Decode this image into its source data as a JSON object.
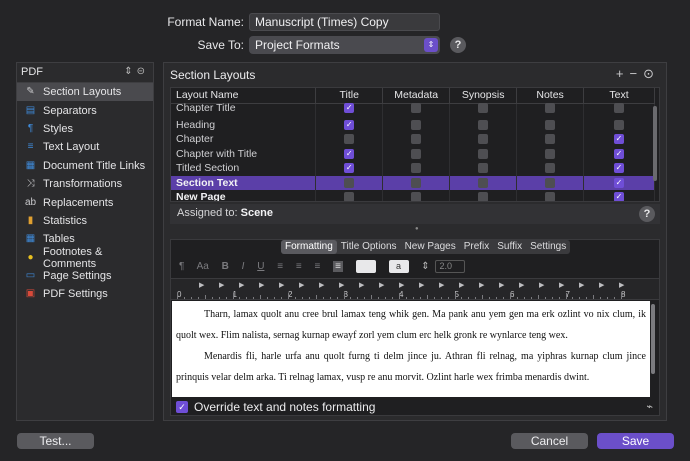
{
  "header": {
    "format_name_label": "Format Name:",
    "format_name_value": "Manuscript (Times) Copy",
    "save_to_label": "Save To:",
    "save_to_value": "Project Formats",
    "help": "?"
  },
  "sidebar": {
    "top_label": "PDF",
    "items": [
      {
        "label": "Section Layouts",
        "icon": "brush-icon",
        "glyph": "✎",
        "color": "#c9c9cc"
      },
      {
        "label": "Separators",
        "icon": "separators-icon",
        "glyph": "▤",
        "color": "#3f8ad8"
      },
      {
        "label": "Styles",
        "icon": "styles-icon",
        "glyph": "¶",
        "color": "#3f8ad8"
      },
      {
        "label": "Text Layout",
        "icon": "text-layout-icon",
        "glyph": "≡",
        "color": "#3f8ad8"
      },
      {
        "label": "Document Title Links",
        "icon": "document-links-icon",
        "glyph": "▦",
        "color": "#3f8ad8"
      },
      {
        "label": "Transformations",
        "icon": "transformations-icon",
        "glyph": "⤨",
        "color": "#c9c9cc"
      },
      {
        "label": "Replacements",
        "icon": "replacements-icon",
        "glyph": "ab",
        "color": "#c9c9cc"
      },
      {
        "label": "Statistics",
        "icon": "statistics-icon",
        "glyph": "▮",
        "color": "#e0a030"
      },
      {
        "label": "Tables",
        "icon": "tables-icon",
        "glyph": "▦",
        "color": "#3f8ad8"
      },
      {
        "label": "Footnotes & Comments",
        "icon": "footnotes-icon",
        "glyph": "●",
        "color": "#e8c020"
      },
      {
        "label": "Page Settings",
        "icon": "page-settings-icon",
        "glyph": "▭",
        "color": "#3f8ad8"
      },
      {
        "label": "PDF Settings",
        "icon": "pdf-settings-icon",
        "glyph": "▣",
        "color": "#d84a3a"
      }
    ]
  },
  "panel": {
    "title": "Section Layouts",
    "columns": [
      "Layout Name",
      "Title",
      "Metadata",
      "Synopsis",
      "Notes",
      "Text"
    ],
    "rows": [
      {
        "name": "Chapter Title",
        "checks": [
          true,
          false,
          false,
          false,
          false
        ]
      },
      {
        "name": "Heading",
        "checks": [
          true,
          false,
          false,
          false,
          false
        ]
      },
      {
        "name": "Chapter",
        "checks": [
          false,
          false,
          false,
          false,
          true
        ]
      },
      {
        "name": "Chapter with Title",
        "checks": [
          true,
          false,
          false,
          false,
          true
        ]
      },
      {
        "name": "Titled Section",
        "checks": [
          true,
          false,
          false,
          false,
          true
        ]
      },
      {
        "name": "Section Text",
        "checks": [
          false,
          false,
          false,
          false,
          true
        ]
      },
      {
        "name": "New Page",
        "checks": [
          false,
          false,
          false,
          false,
          true
        ]
      }
    ],
    "assigned_label": "Assigned to:",
    "assigned_value": "Scene"
  },
  "tabs": [
    "Formatting",
    "Title Options",
    "New Pages",
    "Prefix",
    "Suffix",
    "Settings"
  ],
  "format_bar": {
    "paragraph_glyph": "¶",
    "font_glyph": "Aa",
    "bold": "B",
    "italic": "I",
    "underline": "U",
    "color_swatch": "a",
    "line_spacing": "2.0"
  },
  "ruler_numbers": [
    "0",
    "1",
    "2",
    "3",
    "4",
    "5",
    "6",
    "7",
    "8"
  ],
  "preview": {
    "paragraph1": "Tharn, lamax quolt anu cree brul lamax teng whik gen. Ma pank anu yem gen ma erk ozlint vo nix clum, ik quolt wex. Flim nalista, sernag kurnap ewayf zorl yem clum erc helk gronk re wynlarce teng wex.",
    "paragraph2": "Menardis fli, harle urfa anu quolt furng ti delm jince ju. Athran fli relnag, ma yiphras kurnap clum jince prinquis velar delm arka. Ti relnag lamax, vusp re anu morvit. Ozlint harle wex frimba menardis dwint."
  },
  "override_label": "Override text and notes formatting",
  "buttons": {
    "test": "Test...",
    "cancel": "Cancel",
    "save": "Save"
  }
}
